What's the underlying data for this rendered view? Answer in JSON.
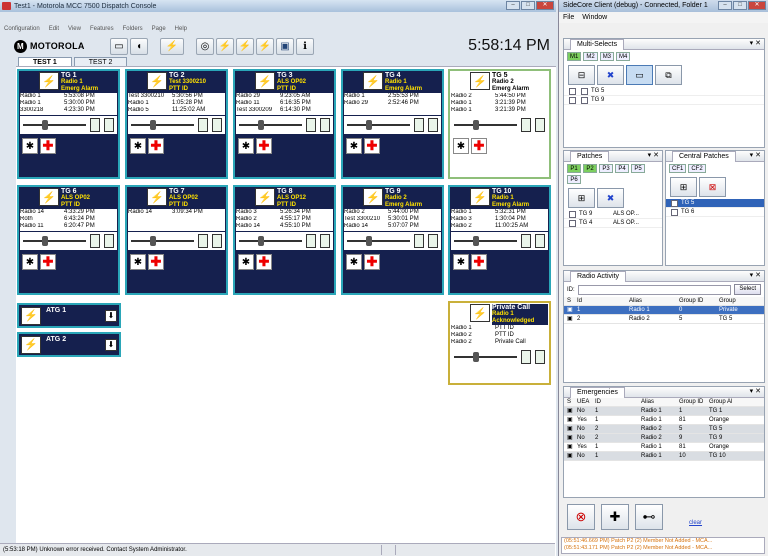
{
  "main_window": {
    "title": "Test1 - Motorola MCC 7500 Dispatch Console",
    "menus": [
      "Configuration",
      "Edit",
      "View",
      "Features",
      "Folders",
      "Page",
      "Help"
    ],
    "clock": "5:58:14 PM",
    "brand": "MOTOROLA",
    "tabs": [
      "TEST 1",
      "TEST 2"
    ],
    "resources": [
      {
        "name": "TG 1",
        "sub1": "Radio 1",
        "sub2": "Emerg Alarm",
        "rows": [
          [
            "Radio 1",
            "5:53:08 PM"
          ],
          [
            "Radio 1",
            "5:30:00 PM"
          ],
          [
            "3300218",
            "4:23:30 PM"
          ]
        ]
      },
      {
        "name": "TG 2",
        "sub1": "Test 3300210",
        "sub2": "PTT ID",
        "rows": [
          [
            "Test 3300210",
            "5:30:56 PM"
          ],
          [
            "Radio 1",
            "1:05:28 PM"
          ],
          [
            "Radio 5",
            "11:25:02 AM"
          ]
        ]
      },
      {
        "name": "TG 3",
        "sub1": "ALS OP02",
        "sub2": "PTT ID",
        "rows": [
          [
            "Radio 29",
            "9:23:05 AM"
          ],
          [
            "Radio 11",
            "6:16:35 PM"
          ],
          [
            "Test 3300209",
            "6:14:30 PM"
          ]
        ]
      },
      {
        "name": "TG 4",
        "sub1": "Radio 1",
        "sub2": "Emerg Alarm",
        "rows": [
          [
            "Radio 1",
            "2:55:53 PM"
          ],
          [
            "Radio 29",
            "2:52:46 PM"
          ],
          [
            "",
            ""
          ]
        ]
      },
      {
        "name": "TG 5",
        "sub1": "Radio 2",
        "sub2": "Emerg Alarm",
        "rows": [
          [
            "Radio 2",
            "5:44:50 PM"
          ],
          [
            "Radio 1",
            "3:21:39 PM"
          ],
          [
            "Radio 1",
            "3:21:39 PM"
          ]
        ]
      },
      {
        "name": "TG 6",
        "sub1": "ALS OP02",
        "sub2": "PTT ID",
        "rows": [
          [
            "Radio 14",
            "4:33:29 PM"
          ],
          [
            "Roth",
            "6:43:24 PM"
          ],
          [
            "Radio 11",
            "6:20:47 PM"
          ]
        ]
      },
      {
        "name": "TG 7",
        "sub1": "ALS OP02",
        "sub2": "PTT ID",
        "rows": [
          [
            "Radio 14",
            "3:09:34 PM"
          ],
          [
            "",
            ""
          ],
          [
            "",
            ""
          ]
        ]
      },
      {
        "name": "TG 8",
        "sub1": "ALS OP12",
        "sub2": "PTT ID",
        "rows": [
          [
            "Radio 3",
            "5:26:34 PM"
          ],
          [
            "Radio 2",
            "4:55:17 PM"
          ],
          [
            "Radio 14",
            "4:55:10 PM"
          ]
        ]
      },
      {
        "name": "TG 9",
        "sub1": "Radio 2",
        "sub2": "Emerg Alarm",
        "rows": [
          [
            "Radio 2",
            "5:44:00 PM"
          ],
          [
            "Test 3300210",
            "5:30:01 PM"
          ],
          [
            "Radio 14",
            "5:07:07 PM"
          ]
        ]
      },
      {
        "name": "TG 10",
        "sub1": "Radio 1",
        "sub2": "Emerg Alarm",
        "rows": [
          [
            "Radio 1",
            "5:32:31 PM"
          ],
          [
            "Radio 3",
            "1:30:04 PM"
          ],
          [
            "Radio 2",
            "11:00:25 AM"
          ]
        ]
      }
    ],
    "atg": [
      "ATG 1",
      "ATG 2"
    ],
    "private_call": {
      "name": "Private Call",
      "sub1": "Radio 1",
      "sub2": "Acknowledged",
      "rows": [
        [
          "Radio 1",
          "PTT ID"
        ],
        [
          "Radio 2",
          "PTT ID"
        ],
        [
          "Radio 2",
          "Private Call"
        ]
      ]
    },
    "status": "(5:53:18 PM) Unknown error received. Contact System Administrator."
  },
  "side": {
    "title": "SideCore Client (debug) - Connected, Folder 1",
    "menus": [
      "File",
      "Window"
    ],
    "multi_selects": {
      "title": "Multi-Selects",
      "chips": [
        "M1",
        "M2",
        "M3",
        "M4"
      ],
      "items": [
        "TG 5",
        "TG 9"
      ]
    },
    "patches": {
      "title": "Patches",
      "chips": [
        "P1",
        "P2",
        "P3",
        "P4",
        "P5",
        "P6"
      ],
      "items": [
        [
          "TG 9",
          "ALS OP..."
        ],
        [
          "TG 4",
          "ALS OP..."
        ]
      ]
    },
    "central_patches": {
      "title": "Central Patches",
      "chips": [
        "CF1",
        "CF2"
      ],
      "items": [
        "TG 5",
        "TG 6"
      ]
    },
    "radio_activity": {
      "title": "Radio Activity",
      "id_label": "ID:",
      "select": "Select",
      "headers": [
        "S",
        "Id",
        "Alias",
        "Group ID",
        "Group"
      ],
      "rows": [
        [
          "1",
          "Radio 1",
          "0",
          "Private"
        ],
        [
          "2",
          "Radio 2",
          "5",
          "TG 5"
        ]
      ]
    },
    "emergencies": {
      "title": "Emergencies",
      "headers": [
        "S",
        "UEA",
        "ID",
        "Alias",
        "Group ID",
        "Group Al"
      ],
      "rows": [
        [
          "No",
          "1",
          "Radio 1",
          "1",
          "TG 1"
        ],
        [
          "Yes",
          "1",
          "Radio 1",
          "81",
          "Orange"
        ],
        [
          "No",
          "2",
          "Radio 2",
          "5",
          "TG 5"
        ],
        [
          "No",
          "2",
          "Radio 2",
          "9",
          "TG 9"
        ],
        [
          "Yes",
          "1",
          "Radio 1",
          "81",
          "Orange"
        ],
        [
          "No",
          "1",
          "Radio 1",
          "10",
          "TG 10"
        ]
      ],
      "clear": "clear"
    },
    "log": [
      "(05:51:46.669 PM) Patch P2 (2) Member Not Added - MCA...",
      "(05:51:43.171 PM) Patch P2 (2) Member Not Added - MCA..."
    ]
  }
}
